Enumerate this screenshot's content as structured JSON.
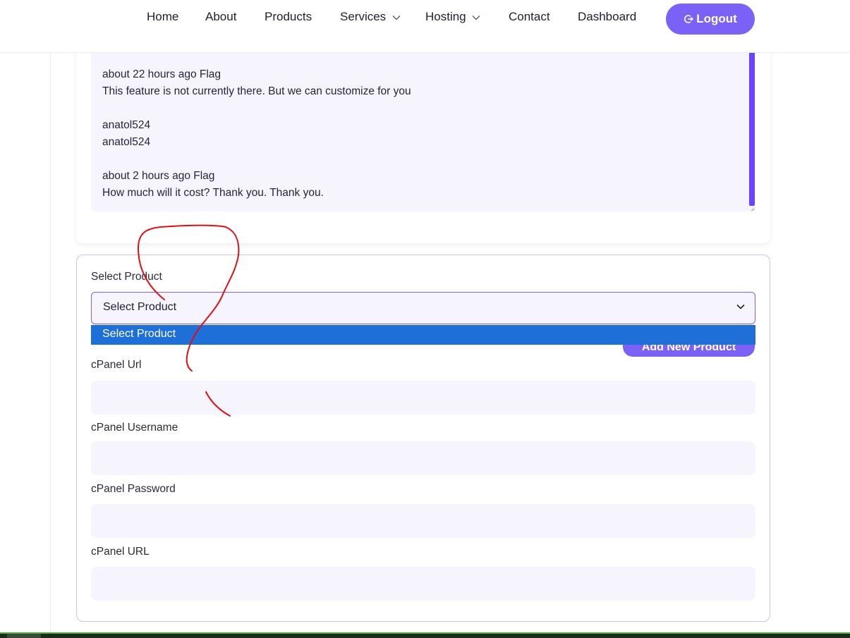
{
  "nav": {
    "items": [
      {
        "label": "Home"
      },
      {
        "label": "About"
      },
      {
        "label": "Products"
      },
      {
        "label": "Services"
      },
      {
        "label": "Hosting"
      },
      {
        "label": "Contact"
      },
      {
        "label": "Dashboard"
      }
    ],
    "logout_label": "Logout",
    "accent": "#7b61f6"
  },
  "comments": {
    "lines": [
      "about 22 hours ago Flag",
      "This feature is not currently there. But we can customize for you",
      "",
      "anatol524",
      "anatol524",
      "",
      "about 2 hours ago Flag",
      "How much will it cost? Thank you.  Thank you."
    ]
  },
  "form": {
    "select_label": "Select Product",
    "select_value": "Select Product",
    "dropdown_option": "Select Product",
    "add_button": "Add New Product",
    "cpanel_url_label": "cPanel Url",
    "cpanel_username_label": "cPanel Username",
    "cpanel_password_label": "cPanel Password",
    "cpanel_url2_label": "cPanel URL"
  },
  "colors": {
    "dropdown_highlight": "#1e6fd8",
    "annotation": "#e01010"
  }
}
